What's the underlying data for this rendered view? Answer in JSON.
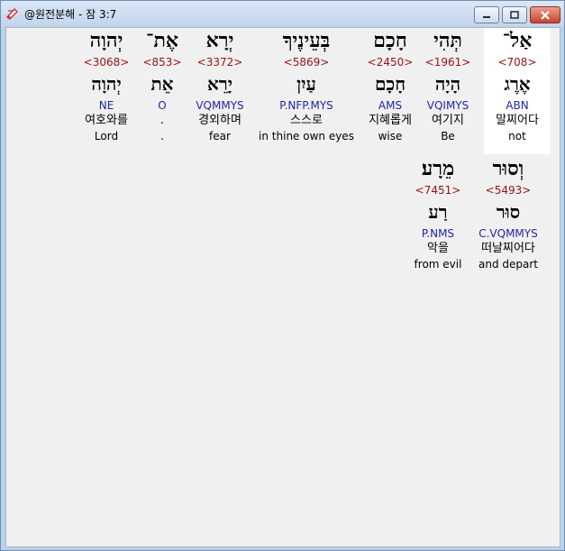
{
  "window": {
    "title": "@원전분해 - 잠 3:7"
  },
  "columns": [
    {
      "heb": "אַל־",
      "strong": "<708>",
      "root": "אֶרֶג",
      "parse": "ABN",
      "korean": "말찌어다",
      "english": "not"
    },
    {
      "heb": "תְּהִי",
      "strong": "<1961>",
      "root": "הָיָה",
      "parse": "VQIMYS",
      "korean": "여기지",
      "english": "Be"
    },
    {
      "heb": "חָכָם",
      "strong": "<2450>",
      "root": "חָכָם",
      "parse": "AMS",
      "korean": "지혜롭게",
      "english": "wise"
    },
    {
      "heb": "בְּעֵינֶיךָ",
      "strong": "<5869>",
      "root": "עַיִן",
      "parse": "P.NFP.MYS",
      "korean": "스스로",
      "english": "in thine own eyes"
    },
    {
      "heb": "יְרָא",
      "strong": "<3372>",
      "root": "יָרֵא",
      "parse": "VQMMYS",
      "korean": "경외하며",
      "english": "fear"
    },
    {
      "heb": "אֶת־",
      "strong": "<853>",
      "root": "אֵת",
      "parse": "O",
      "korean": ".",
      "english": "."
    },
    {
      "heb": "יְהוָה",
      "strong": "<3068>",
      "root": "יְהוָה",
      "parse": "NE",
      "korean": "여호와를",
      "english": "Lord"
    },
    {
      "heb": "וְסוּר",
      "strong": "<5493>",
      "root": "סוּר",
      "parse": "C.VQMMYS",
      "korean": "떠날찌어다",
      "english": "and depart"
    },
    {
      "heb": "מֵרָע׃",
      "strong": "<7451>",
      "root": "רַע",
      "parse": "P.NMS",
      "korean": "악을",
      "english": "from evil"
    }
  ]
}
